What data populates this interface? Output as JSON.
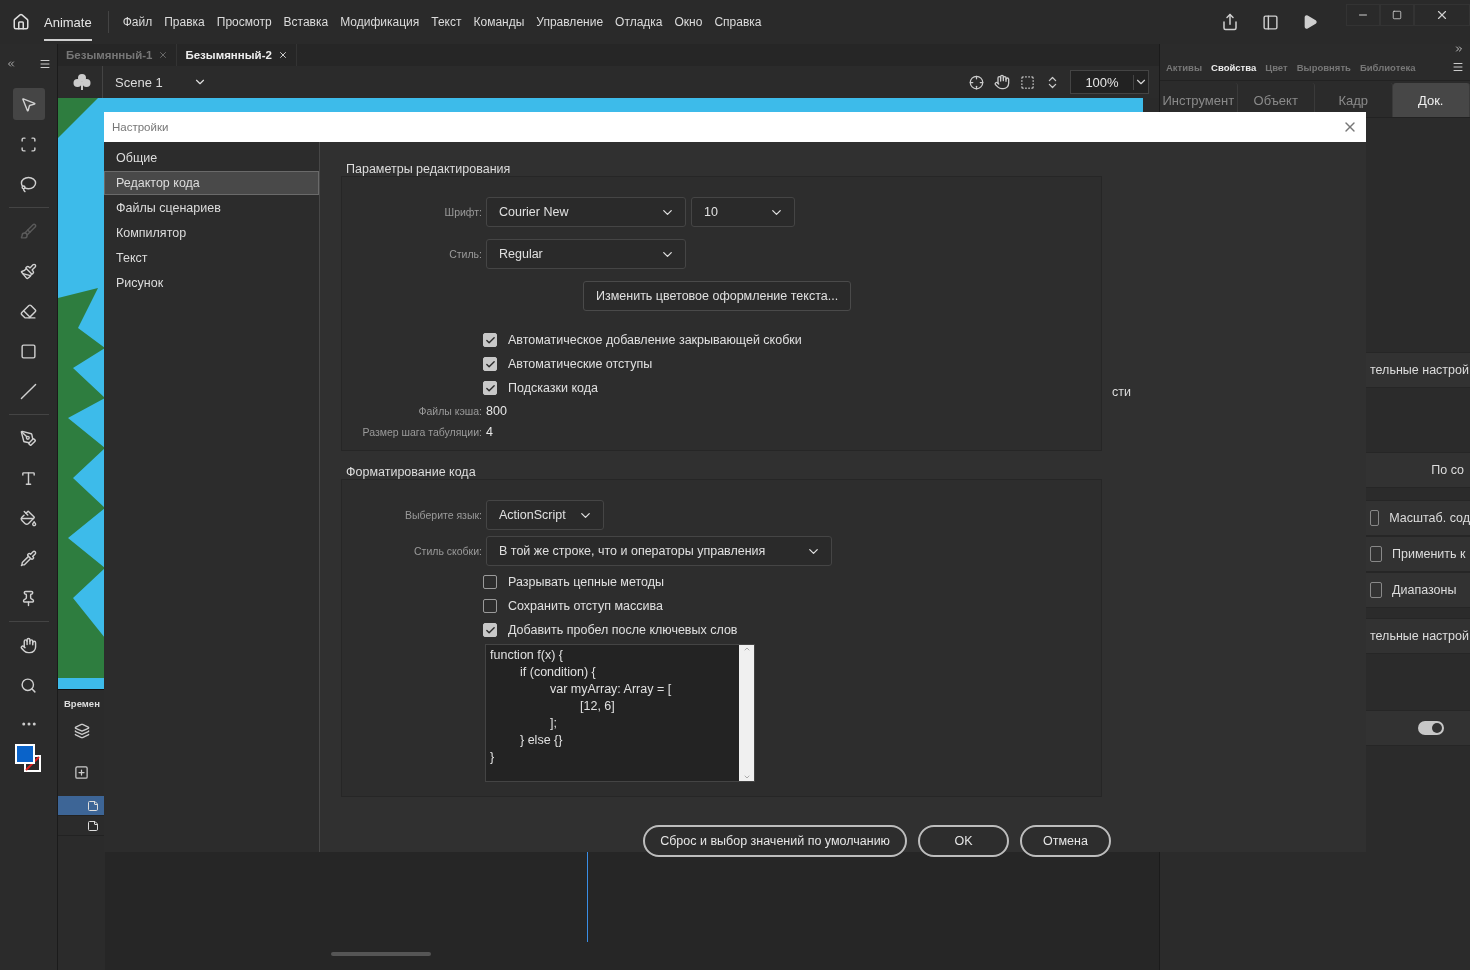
{
  "app": {
    "name": "Animate"
  },
  "menu": [
    "Файл",
    "Правка",
    "Просмотр",
    "Вставка",
    "Модификация",
    "Текст",
    "Команды",
    "Управление",
    "Отладка",
    "Окно",
    "Справка"
  ],
  "documents": [
    {
      "title": "Безымянный-1",
      "selected": false
    },
    {
      "title": "Безымянный-2",
      "selected": true
    }
  ],
  "scene": {
    "name": "Scene 1",
    "zoom": "100%"
  },
  "tools": [
    {
      "selected": true,
      "disabled": false
    },
    {
      "selected": false,
      "disabled": false
    },
    {
      "selected": false,
      "disabled": false
    },
    {
      "selected": false,
      "disabled": true
    },
    {
      "selected": false,
      "disabled": false
    },
    {
      "selected": false,
      "disabled": false
    },
    {
      "selected": false,
      "disabled": false
    },
    {
      "selected": false,
      "disabled": false
    },
    {
      "selected": false,
      "disabled": false
    },
    {
      "selected": false,
      "disabled": false
    },
    {
      "selected": false,
      "disabled": false
    },
    {
      "selected": false,
      "disabled": false
    },
    {
      "selected": false,
      "disabled": false
    },
    {
      "selected": false,
      "disabled": false
    },
    {
      "selected": false,
      "disabled": false
    }
  ],
  "timeline": {
    "title": "Времен",
    "layers": [
      {
        "selected": true
      },
      {
        "selected": false
      }
    ]
  },
  "panel": {
    "tabs": [
      {
        "label": "Активы",
        "selected": false
      },
      {
        "label": "Свойства",
        "selected": true
      },
      {
        "label": "Цвет",
        "selected": false
      },
      {
        "label": "Выровнять",
        "selected": false
      },
      {
        "label": "Библиотека",
        "selected": false
      }
    ],
    "subtabs": [
      {
        "label": "Инструмент",
        "selected": false
      },
      {
        "label": "Объект",
        "selected": false
      },
      {
        "label": "Кадр",
        "selected": false
      },
      {
        "label": "Док.",
        "selected": true
      }
    ],
    "rows": [
      {
        "kind": "section",
        "label": "тельные настрой"
      },
      {
        "kind": "value",
        "label": "По со"
      },
      {
        "kind": "checkbox",
        "label": "Масштаб. сод",
        "checked": false
      },
      {
        "kind": "checkbox",
        "label": "Применить к",
        "checked": false
      },
      {
        "kind": "checkbox",
        "label": "Диапазоны",
        "checked": false
      },
      {
        "kind": "section",
        "label": "тельные настрой"
      },
      {
        "kind": "toggle",
        "on": true
      }
    ]
  },
  "dialog": {
    "title": "Настройки",
    "categories": [
      {
        "label": "Общие",
        "selected": false
      },
      {
        "label": "Редактор кода",
        "selected": true
      },
      {
        "label": "Файлы сценариев",
        "selected": false
      },
      {
        "label": "Компилятор",
        "selected": false
      },
      {
        "label": "Текст",
        "selected": false
      },
      {
        "label": "Рисунок",
        "selected": false
      }
    ],
    "editing": {
      "title": "Параметры редактирования",
      "font_label": "Шрифт:",
      "font": "Courier New",
      "size": "10",
      "style_label": "Стиль:",
      "style": "Regular",
      "color_button": "Изменить цветовое оформление текста...",
      "options": [
        {
          "label": "Автоматическое добавление закрывающей скобки",
          "checked": true
        },
        {
          "label": "Автоматические отступы",
          "checked": true
        },
        {
          "label": "Подсказки кода",
          "checked": true
        }
      ],
      "cache_label": "Файлы кэша:",
      "cache": "800",
      "tab_label": "Размер шага табуляции:",
      "tab": "4"
    },
    "side_text": "сти",
    "formatting": {
      "title": "Форматирование кода",
      "language_label": "Выберите язык:",
      "language": "ActionScript",
      "brace_label": "Стиль скобки:",
      "brace": "В той же строке, что и операторы управления",
      "options": [
        {
          "label": "Разрывать цепные методы",
          "checked": false
        },
        {
          "label": "Сохранить отступ массива",
          "checked": false
        },
        {
          "label": "Добавить пробел после ключевых слов",
          "checked": true
        }
      ],
      "preview": [
        "function f(x) {",
        "\tif (condition) {",
        "\t\tvar myArray: Array = [",
        "\t\t\t[12, 6]",
        "\t\t];",
        "\t} else {}",
        "}"
      ]
    },
    "buttons": [
      "Сброс и выбор значений по умолчанию",
      "OK",
      "Отмена"
    ]
  }
}
